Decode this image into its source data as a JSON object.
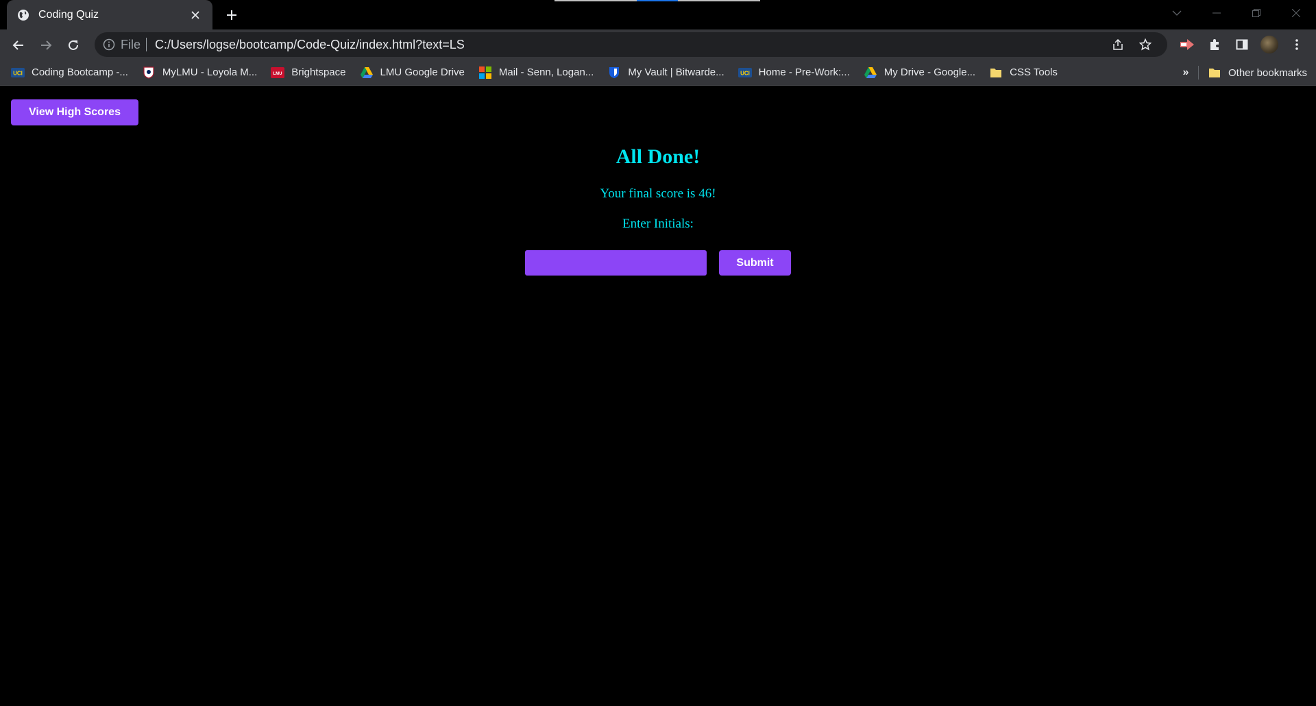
{
  "browser": {
    "tab": {
      "title": "Coding Quiz"
    },
    "address": {
      "scheme": "File",
      "url": "C:/Users/logse/bootcamp/Code-Quiz/index.html?text=LS"
    },
    "bookmarks": [
      {
        "label": "Coding Bootcamp -...",
        "icon": "uci-icon"
      },
      {
        "label": "MyLMU - Loyola M...",
        "icon": "shield-icon"
      },
      {
        "label": "Brightspace",
        "icon": "lmu-icon"
      },
      {
        "label": "LMU Google Drive",
        "icon": "google-drive-icon"
      },
      {
        "label": "Mail - Senn, Logan...",
        "icon": "microsoft-icon"
      },
      {
        "label": "My Vault | Bitwarde...",
        "icon": "bitwarden-icon"
      },
      {
        "label": "Home - Pre-Work:...",
        "icon": "uci-icon"
      },
      {
        "label": "My Drive - Google...",
        "icon": "google-drive-icon"
      },
      {
        "label": "CSS Tools",
        "icon": "folder-icon"
      }
    ],
    "bookmarks_overflow": "»",
    "other_bookmarks": "Other bookmarks"
  },
  "page": {
    "view_scores_label": "View High Scores",
    "heading": "All Done!",
    "final_score_text": "Your final score is 46!",
    "initials_label": "Enter Initials:",
    "initials_value": "",
    "submit_label": "Submit"
  },
  "colors": {
    "accent_purple": "#8c45f6",
    "text_cyan": "#00e5f0",
    "background": "#000000"
  }
}
